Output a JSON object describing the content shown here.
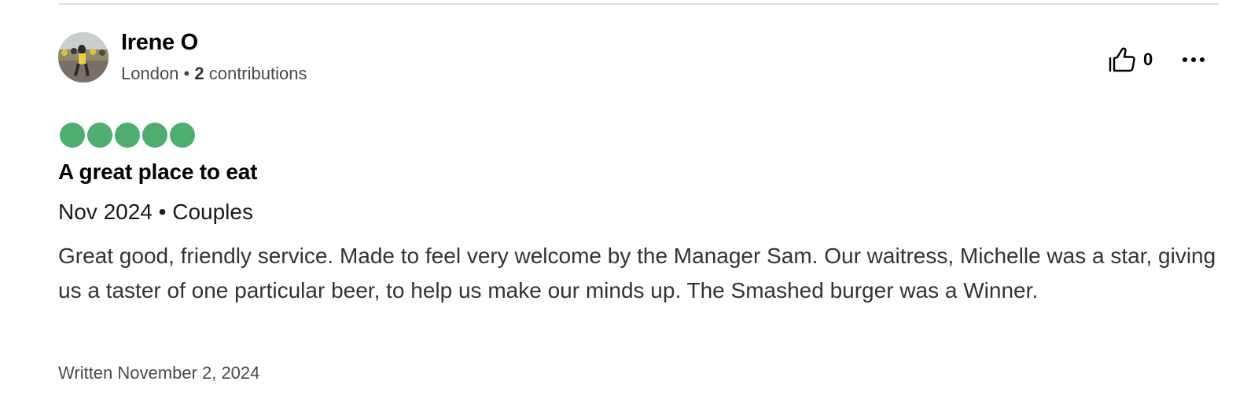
{
  "review": {
    "user": {
      "name": "Irene O",
      "location": "London",
      "separator": " • ",
      "contributions_count": "2",
      "contributions_label": " contributions"
    },
    "helpful_votes": "0",
    "rating": {
      "value": 5,
      "max": 5,
      "color": "#4fad6f"
    },
    "title": "A great place to eat",
    "trip_info": "Nov 2024 • Couples",
    "body": "Great good, friendly service. Made to feel very welcome by the Manager Sam. Our waitress, Michelle was a star, giving us a taster of one particular beer, to help us make our minds up. The Smashed burger was a Winner.",
    "written_date": "Written November 2, 2024"
  },
  "icons": {
    "like": "thumbs-up-icon",
    "more": "more-options-icon"
  }
}
